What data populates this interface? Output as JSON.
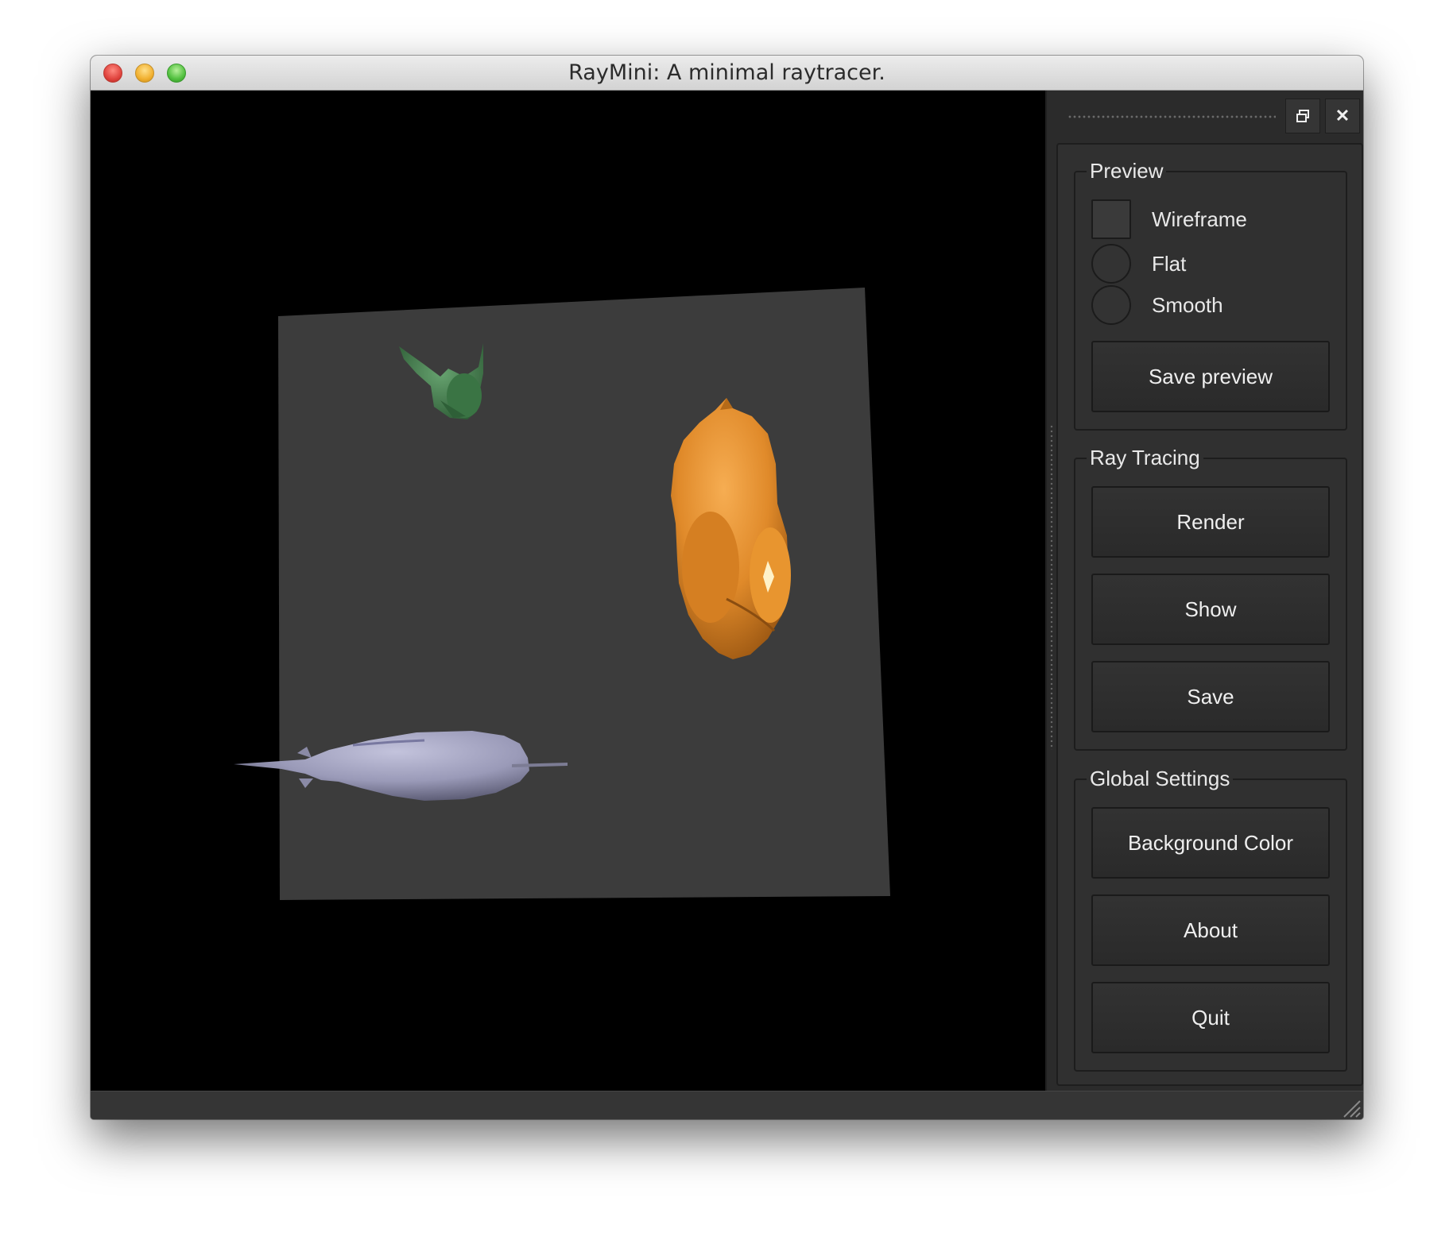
{
  "window": {
    "title": "RayMini: A minimal raytracer."
  },
  "dock": {
    "float_icon": "float-window-icon",
    "close_icon": "close-icon",
    "close_glyph": "✕"
  },
  "preview": {
    "title": "Preview",
    "wireframe_label": "Wireframe",
    "wireframe_checked": false,
    "flat_label": "Flat",
    "flat_selected": false,
    "smooth_label": "Smooth",
    "smooth_selected": false,
    "save_preview_label": "Save preview"
  },
  "ray_tracing": {
    "title": "Ray Tracing",
    "render_label": "Render",
    "show_label": "Show",
    "save_label": "Save"
  },
  "global_settings": {
    "title": "Global Settings",
    "background_color_label": "Background Color",
    "about_label": "About",
    "quit_label": "Quit"
  },
  "colors": {
    "viewport_background": "#000000",
    "ground_plane": "#3c3c3c",
    "gargoyle": "#3f7d4a",
    "orange_model": "#e08a2a",
    "lavender_model": "#9a9ab8"
  }
}
